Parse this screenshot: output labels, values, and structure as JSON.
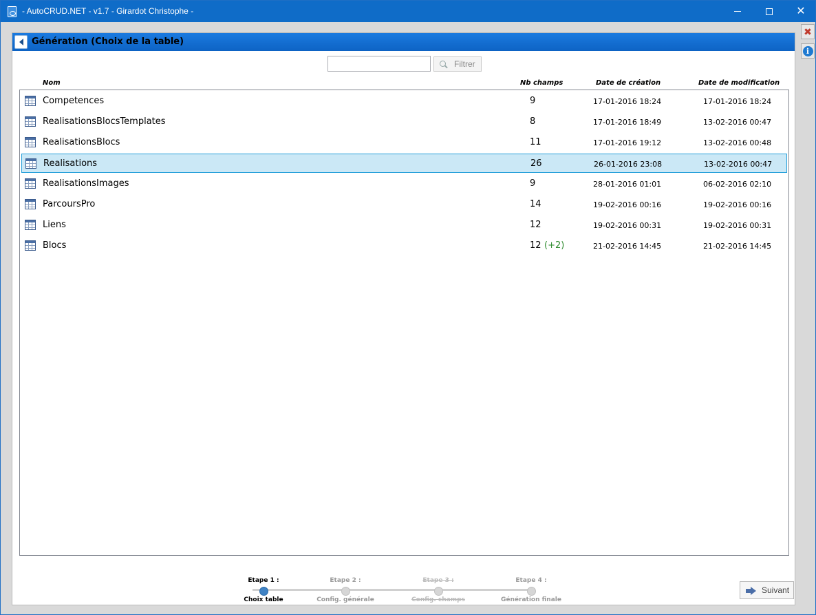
{
  "window": {
    "title": "- AutoCRUD.NET - v1.7 - Girardot Christophe -",
    "icon": "app-file-icon"
  },
  "side_tools": {
    "tools_icon": "tools-icon",
    "info_icon": "info-icon"
  },
  "panel": {
    "title": "Génération (Choix de la table)",
    "back_icon": "back-arrow-icon"
  },
  "search": {
    "value": "",
    "filter_label": "Filtrer",
    "filter_icon": "search-icon"
  },
  "table": {
    "headers": {
      "name": "Nom",
      "fields": "Nb champs",
      "created": "Date de création",
      "modified": "Date de modification"
    },
    "rows": [
      {
        "name": "Competences",
        "fields": "9",
        "extra": "",
        "created": "17-01-2016 18:24",
        "modified": "17-01-2016 18:24",
        "selected": false
      },
      {
        "name": "RealisationsBlocsTemplates",
        "fields": "8",
        "extra": "",
        "created": "17-01-2016 18:49",
        "modified": "13-02-2016 00:47",
        "selected": false
      },
      {
        "name": "RealisationsBlocs",
        "fields": "11",
        "extra": "",
        "created": "17-01-2016 19:12",
        "modified": "13-02-2016 00:48",
        "selected": false
      },
      {
        "name": "Realisations",
        "fields": "26",
        "extra": "",
        "created": "26-01-2016 23:08",
        "modified": "13-02-2016 00:47",
        "selected": true
      },
      {
        "name": "RealisationsImages",
        "fields": "9",
        "extra": "",
        "created": "28-01-2016 01:01",
        "modified": "06-02-2016 02:10",
        "selected": false
      },
      {
        "name": "ParcoursPro",
        "fields": "14",
        "extra": "",
        "created": "19-02-2016 00:16",
        "modified": "19-02-2016 00:16",
        "selected": false
      },
      {
        "name": "Liens",
        "fields": "12",
        "extra": "",
        "created": "19-02-2016 00:31",
        "modified": "19-02-2016 00:31",
        "selected": false
      },
      {
        "name": "Blocs",
        "fields": "12",
        "extra": "(+2)",
        "created": "21-02-2016 14:45",
        "modified": "21-02-2016 14:45",
        "selected": false
      }
    ]
  },
  "stepper": {
    "steps": [
      {
        "top": "Etape 1 :",
        "bottom": "Choix table",
        "state": "active"
      },
      {
        "top": "Etape 2 :",
        "bottom": "Config. générale",
        "state": "inactive"
      },
      {
        "top": "Etape 3 :",
        "bottom": "Config. champs",
        "state": "disabled"
      },
      {
        "top": "Etape 4 :",
        "bottom": "Génération finale",
        "state": "inactive"
      }
    ]
  },
  "next_button": {
    "label": "Suivant",
    "icon": "arrow-right-icon"
  },
  "colors": {
    "titlebar": "#0f6cc8",
    "panel_header": "#1b7ae0",
    "selected_row": "#cbe8f6",
    "extra_green": "#2e8b2e",
    "active_step": "#3f82c4"
  }
}
